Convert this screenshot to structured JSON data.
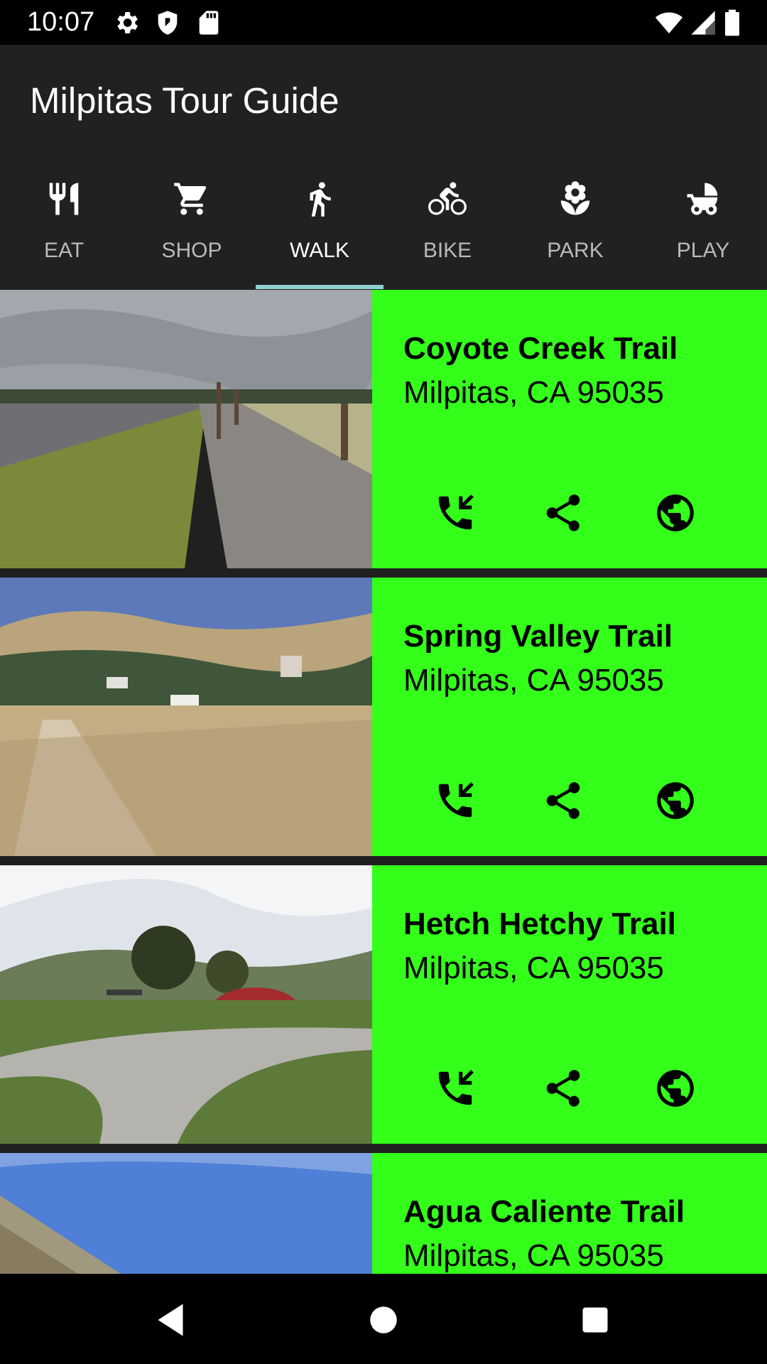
{
  "status_bar": {
    "time": "10:07",
    "left_icons": [
      "gear-icon",
      "shield-icon",
      "sd-card-icon"
    ],
    "right_icons": [
      "wifi-icon",
      "signal-icon",
      "battery-icon"
    ]
  },
  "app_bar": {
    "title": "Milpitas Tour Guide"
  },
  "tabs": [
    {
      "label": "EAT",
      "icon": "fork-knife-icon"
    },
    {
      "label": "SHOP",
      "icon": "cart-icon"
    },
    {
      "label": "WALK",
      "icon": "walk-icon",
      "selected": true
    },
    {
      "label": "BIKE",
      "icon": "bike-icon"
    },
    {
      "label": "PARK",
      "icon": "flower-icon"
    },
    {
      "label": "PLAY",
      "icon": "stroller-icon"
    }
  ],
  "places": [
    {
      "name": "Coyote Creek Trail",
      "address": "Milpitas, CA 95035"
    },
    {
      "name": "Spring Valley Trail",
      "address": "Milpitas, CA 95035"
    },
    {
      "name": "Hetch Hetchy Trail",
      "address": "Milpitas, CA 95035"
    },
    {
      "name": "Agua Caliente Trail",
      "address": "Milpitas, CA 95035"
    }
  ],
  "card_actions": [
    "phone-icon",
    "share-icon",
    "globe-icon"
  ],
  "colors": {
    "card_background": "#33ff1a",
    "app_bar": "#212121",
    "tab_indicator": "#8fd0d0"
  },
  "nav_bar": [
    "back-icon",
    "home-icon",
    "recents-icon"
  ]
}
